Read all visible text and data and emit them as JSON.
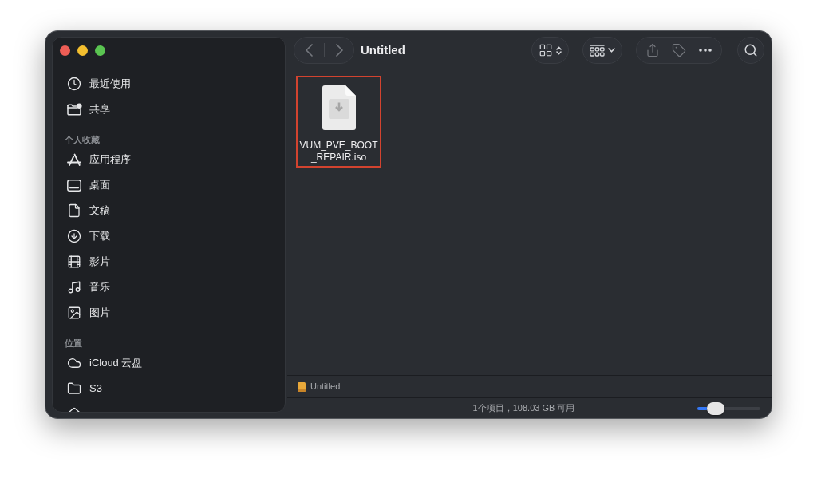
{
  "window": {
    "controls": [
      {
        "color": "#ee5e56"
      },
      {
        "color": "#f4bf2f"
      },
      {
        "color": "#5ac451"
      }
    ]
  },
  "sidebar": {
    "sections": [
      {
        "items": [
          {
            "kind": "recents",
            "label": "最近使用",
            "selected": false
          },
          {
            "kind": "shared",
            "label": "共享",
            "selected": false
          }
        ]
      },
      {
        "title": "个人收藏",
        "items": [
          {
            "kind": "applications",
            "label": "应用程序",
            "selected": false
          },
          {
            "kind": "desktop",
            "label": "桌面",
            "selected": false
          },
          {
            "kind": "documents",
            "label": "文稿",
            "selected": false
          },
          {
            "kind": "downloads",
            "label": "下载",
            "selected": false
          },
          {
            "kind": "movies",
            "label": "影片",
            "selected": false
          },
          {
            "kind": "music",
            "label": "音乐",
            "selected": false
          },
          {
            "kind": "pictures",
            "label": "图片",
            "selected": false
          }
        ]
      },
      {
        "title": "位置",
        "items": [
          {
            "kind": "icloud",
            "label": "iCloud 云盘",
            "selected": false
          },
          {
            "kind": "folder",
            "label": "S3",
            "selected": false
          },
          {
            "kind": "home",
            "selected": false
          }
        ]
      }
    ]
  },
  "toolbar": {
    "title": "Untitled",
    "buttons": [
      {
        "kind": "back",
        "disabled": true
      },
      {
        "kind": "forward",
        "disabled": true
      },
      {
        "kind": "view",
        "disabled": false
      },
      {
        "kind": "group",
        "disabled": false
      },
      {
        "kind": "share",
        "disabled": true
      },
      {
        "kind": "tag",
        "disabled": true
      },
      {
        "kind": "more",
        "disabled": false
      },
      {
        "kind": "search",
        "disabled": false
      }
    ]
  },
  "files": [
    {
      "kind": "disk-image",
      "name": "VUM_PVE_BOOT_REPAIR.iso",
      "selected": false,
      "highlighted": true
    }
  ],
  "path_bar": [
    {
      "kind": "volume",
      "label": "Untitled"
    }
  ],
  "status_bar": {
    "text": "1个项目，108.03 GB 可用",
    "zoom_slider": {
      "level": 0.15
    }
  }
}
